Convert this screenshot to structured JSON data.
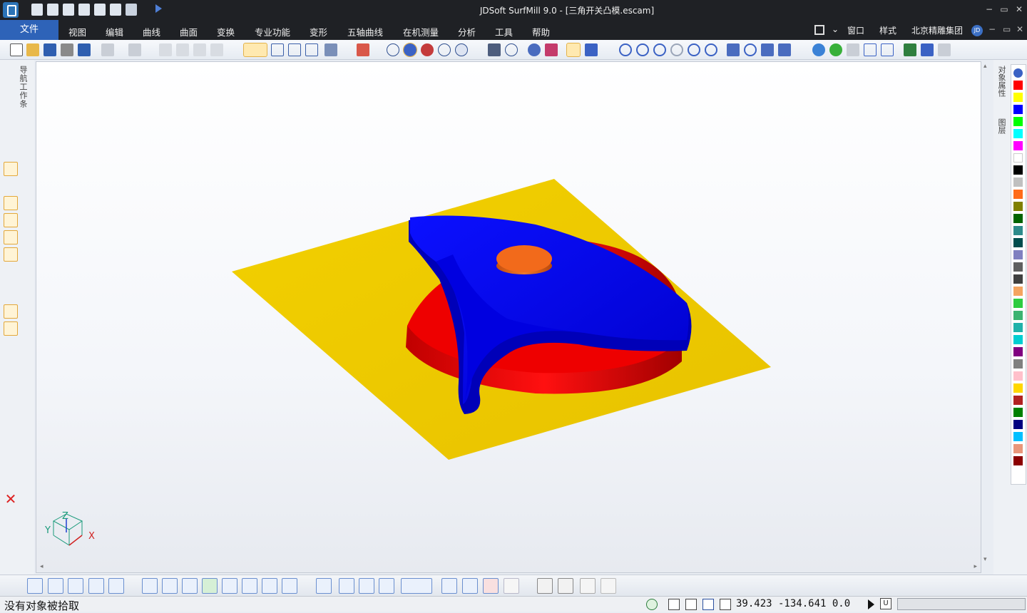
{
  "window": {
    "title": "JDSoft SurfMill 9.0 - [三角开关凸模.escam]",
    "minimize": "−",
    "restore": "▭",
    "close": "✕"
  },
  "menubar": {
    "file": "文件",
    "items": [
      "视图",
      "编辑",
      "曲线",
      "曲面",
      "变换",
      "专业功能",
      "变形",
      "五轴曲线",
      "在机测量",
      "分析",
      "工具",
      "帮助"
    ],
    "right": {
      "window": "窗口",
      "style": "样式",
      "company": "北京精雕集团",
      "avatar": "JD"
    }
  },
  "left_panel": {
    "nav_tab": "导航工作条"
  },
  "right_panel": {
    "tab_properties": "对象属性",
    "tab_layers": "图层",
    "palette_colors": [
      "#ff0000",
      "#ffff00",
      "#0000ff",
      "#00ff00",
      "#00ffff",
      "#ff00ff",
      "#ffffff",
      "#000000",
      "#c0c0c0",
      "#ff6b1a",
      "#808000",
      "#006400",
      "#2e8b8b",
      "#004d4d",
      "#8080c0",
      "#606060",
      "#404040",
      "#f4a460",
      "#2ecc40",
      "#3cb371",
      "#20b2aa",
      "#00ced1",
      "#800080",
      "#808080",
      "#ffc0cb",
      "#ffd700",
      "#b22222",
      "#008000",
      "#000080",
      "#00bfff",
      "#e9967a",
      "#8b0000"
    ]
  },
  "viewport": {
    "colors": {
      "plate": "#eec900",
      "body": "#0000ee",
      "cylinder": "#ee0000",
      "button": "#f26a1b"
    },
    "axis_labels": {
      "x": "X",
      "y": "Y",
      "z": "Z"
    }
  },
  "status": {
    "message": "没有对象被拾取",
    "coords": "39.423 -134.641 0.0",
    "u_label": "U"
  }
}
